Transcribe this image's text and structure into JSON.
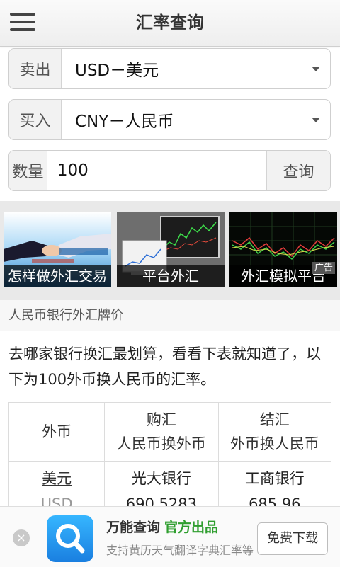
{
  "header": {
    "title": "汇率查询"
  },
  "form": {
    "sell_label": "卖出",
    "sell_value": "USD－美元",
    "buy_label": "买入",
    "buy_value": "CNY－人民币",
    "qty_label": "数量",
    "qty_value": "100",
    "query_label": "查询"
  },
  "banners": [
    {
      "caption": "怎样做外汇交易"
    },
    {
      "caption": "平台外汇"
    },
    {
      "caption": "外汇模拟平台"
    }
  ],
  "banner_ad_tag": "广告",
  "section": {
    "title": "人民币银行外汇牌价",
    "description": "去哪家银行换汇最划算，看看下表就知道了，以下为100外币换人民币的汇率。"
  },
  "table": {
    "headers": [
      {
        "line1": "外币",
        "line2": ""
      },
      {
        "line1": "购汇",
        "line2": "人民币换外币"
      },
      {
        "line1": "结汇",
        "line2": "外币换人民币"
      }
    ],
    "rows": [
      {
        "currency_name": "美元",
        "currency_code": "USD",
        "buy_bank": "光大银行",
        "buy_rate": "690.5283",
        "sell_bank": "工商银行",
        "sell_rate": "685.96"
      }
    ]
  },
  "app_ad": {
    "name": "万能查询",
    "tag": "官方出品",
    "subtitle": "支持黄历天气翻译字典汇率等",
    "download_label": "免费下载",
    "close_symbol": "×"
  },
  "colors": {
    "accent_green": "#2e9e2e",
    "app_blue": "#1a7fe0"
  }
}
